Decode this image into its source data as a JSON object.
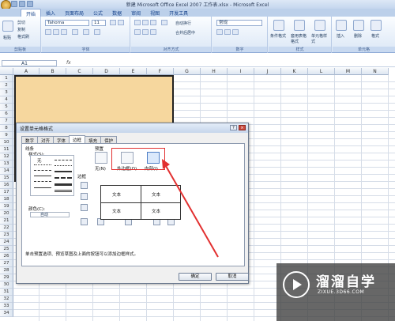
{
  "window": {
    "title": "新建 Microsoft Office Excel 2007 工作表.xlsx - Microsoft Excel"
  },
  "ribbon_tabs": [
    "开始",
    "插入",
    "页面布局",
    "公式",
    "数据",
    "审阅",
    "视图",
    "开发工具"
  ],
  "ribbon": {
    "clipboard": {
      "paste": "粘贴",
      "cut": "剪切",
      "copy": "复制",
      "format_painter": "格式刷",
      "label": "剪贴板"
    },
    "font": {
      "name": "Tahoma",
      "size": "11",
      "label": "字体"
    },
    "alignment": {
      "wrap": "自动换行",
      "merge": "合并后居中",
      "label": "对齐方式"
    },
    "number": {
      "format": "常规",
      "label": "数字"
    },
    "styles": {
      "conditional": "条件格式",
      "table": "套用表格格式",
      "cell": "单元格样式",
      "label": "样式"
    },
    "cells": {
      "insert": "插入",
      "delete": "删除",
      "format": "格式",
      "label": "单元格"
    }
  },
  "formula_bar": {
    "name_box": "A1",
    "fx": "fx"
  },
  "columns": [
    "A",
    "B",
    "C",
    "D",
    "E",
    "F",
    "G",
    "H",
    "I",
    "J",
    "K",
    "L",
    "M",
    "N"
  ],
  "rows": [
    "1",
    "2",
    "3",
    "4",
    "5",
    "6",
    "7",
    "8",
    "9",
    "10",
    "11",
    "12",
    "13",
    "14",
    "15",
    "16",
    "17",
    "18",
    "19",
    "20",
    "21",
    "22",
    "23",
    "24",
    "25",
    "26",
    "27",
    "28",
    "29",
    "30",
    "31",
    "32",
    "33",
    "34"
  ],
  "dialog": {
    "title": "设置单元格格式",
    "tabs": [
      "数字",
      "对齐",
      "字体",
      "边框",
      "填充",
      "保护"
    ],
    "active_tab": "边框",
    "line_section": "线条",
    "style_label": "样式(S):",
    "none_label": "无",
    "color_label": "颜色(C):",
    "color_value": "自动",
    "presets_label": "预置",
    "presets": [
      "无(N)",
      "外边框(O)",
      "内部(I)"
    ],
    "border_label": "边框",
    "preview_cells": [
      "文本",
      "文本",
      "文本",
      "文本"
    ],
    "note": "单击预置选项、预览草图及上面的按钮可以添加边框样式。",
    "ok": "确定",
    "cancel": "取消"
  },
  "watermark": {
    "name": "溜溜自学",
    "url": "ZIXUE.3D66.COM"
  },
  "accent_color": "#e23030",
  "selection_color": "#f6d79e"
}
